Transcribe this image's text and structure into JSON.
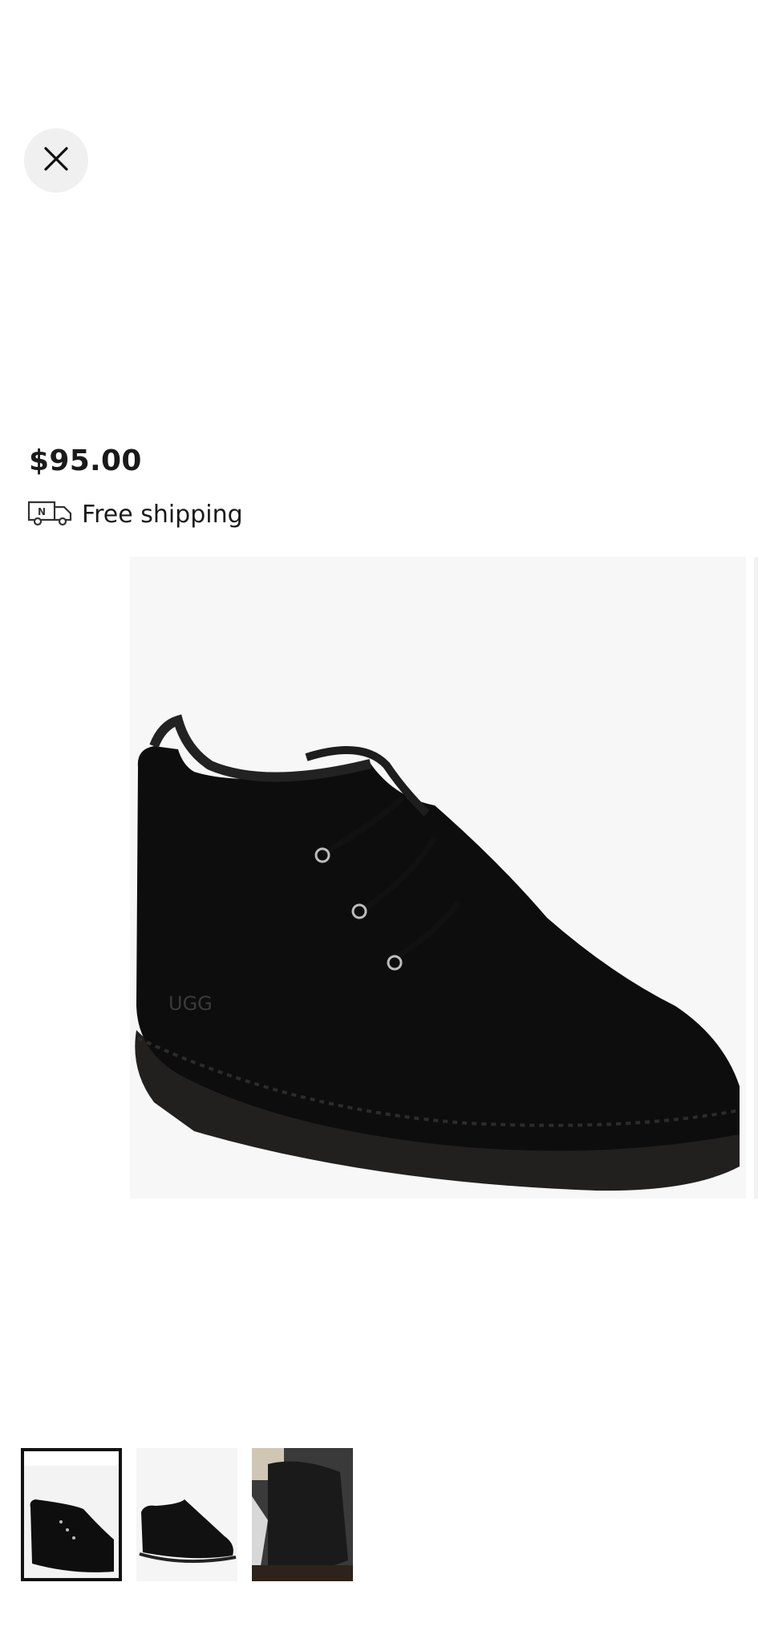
{
  "close": {
    "icon": "close-icon"
  },
  "product": {
    "price": "$95.00",
    "shipping": {
      "icon": "delivery-truck-icon",
      "text": "Free shipping",
      "truck_badge": "N"
    },
    "main_image": {
      "alt": "black suede lace-up chukka boot",
      "logo_mark": "UGG"
    }
  },
  "gallery": {
    "thumbnails": [
      {
        "name": "thumbnail-1",
        "selected": true
      },
      {
        "name": "thumbnail-2",
        "selected": false
      },
      {
        "name": "thumbnail-3",
        "selected": false
      }
    ]
  },
  "colors": {
    "background": "#ffffff",
    "close_bg": "#f0f0f0",
    "image_bg": "#f7f7f7",
    "text": "#1a1a1a"
  }
}
